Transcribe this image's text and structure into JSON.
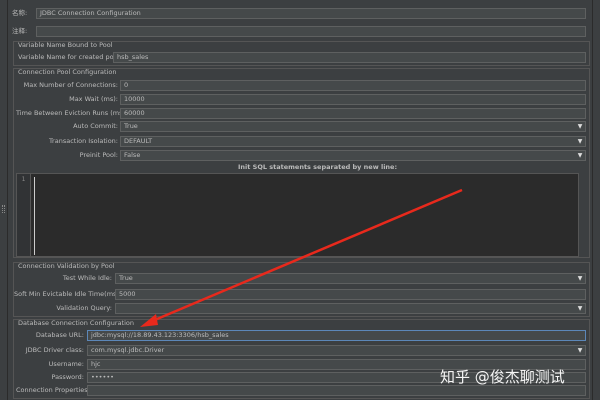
{
  "header": {
    "name_label": "名称:",
    "name_value": "JDBC Connection Configuration",
    "comment_label": "注释:",
    "comment_value": ""
  },
  "variable_section": {
    "title": "Variable Name Bound to Pool",
    "var_label": "Variable Name for created pool:",
    "var_value": "hsb_sales"
  },
  "pool_section": {
    "title": "Connection Pool Configuration",
    "max_conn_label": "Max Number of Connections:",
    "max_conn_value": "0",
    "max_wait_label": "Max Wait (ms):",
    "max_wait_value": "10000",
    "eviction_label": "Time Between Eviction Runs (ms):",
    "eviction_value": "60000",
    "auto_commit_label": "Auto Commit:",
    "auto_commit_value": "True",
    "isolation_label": "Transaction Isolation:",
    "isolation_value": "DEFAULT",
    "preinit_label": "Preinit Pool:",
    "preinit_value": "False",
    "init_sql_label": "Init SQL statements separated by new line:",
    "sql_line_number": "1"
  },
  "validation_section": {
    "title": "Connection Validation by Pool",
    "test_idle_label": "Test While Idle:",
    "test_idle_value": "True",
    "soft_min_label": "Soft Min Evictable Idle Time(ms):",
    "soft_min_value": "5000",
    "validation_query_label": "Validation Query:",
    "validation_query_value": ""
  },
  "db_section": {
    "title": "Database Connection Configuration",
    "url_label": "Database URL:",
    "url_value": "jdbc:mysql://18.89.43.123:3306/hsb_sales",
    "driver_label": "JDBC Driver class:",
    "driver_value": "com.mysql.jdbc.Driver",
    "username_label": "Username:",
    "username_value": "hjc",
    "password_label": "Password:",
    "password_value": "••••••",
    "props_label": "Connection Properties:",
    "props_value": ""
  },
  "watermark": "知乎 @俊杰聊测试",
  "icons": {
    "dropdown": "chevron-down-icon",
    "arrow_color": "#e8291c"
  }
}
